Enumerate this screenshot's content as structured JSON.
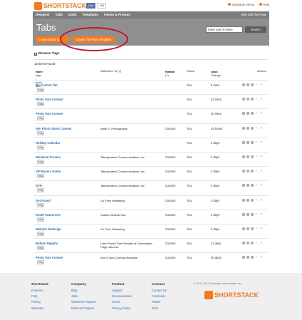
{
  "topbar": {
    "logo_text": "SHORTSTACK",
    "fb_like_label": "Like",
    "fb_like_count": "190",
    "user_name": "Stephanie Sherry",
    "help_label": "Help"
  },
  "nav": {
    "items": [
      "Designer",
      "Tabs",
      "Units",
      "Templates",
      "Forms & Promos"
    ],
    "help_page": "Help with this Page"
  },
  "header": {
    "title": "Tabs",
    "search_placeholder": "Enter part of name",
    "search_button": "Search",
    "create_blank": "Create Blank Tab",
    "create_template": "Create Tab From Template"
  },
  "browse_tags": "Browse Tags",
  "items_found": "13 Items Found",
  "table": {
    "headers": {
      "name": "Name",
      "name_sub": "hide tags | quick add",
      "attribution": "Attribution To (?)",
      "publish": "Publish",
      "publish_sub": "Method (?)",
      "owner": "Owner",
      "shown": "Show",
      "shown_sub": "Last Change",
      "actions": "Actions"
    },
    "rows": [
      {
        "name": "My Contest Tab",
        "tag": "blog",
        "attr": "",
        "pub": "",
        "owner": "You",
        "shown": "5 mins"
      },
      {
        "name": "Photo Vote Contest",
        "tag": "blog",
        "attr": "",
        "pub": "",
        "owner": "You",
        "shown": "22 mins"
      },
      {
        "name": "Photo Vote Contest",
        "tag": "blog",
        "attr": "",
        "pub": "",
        "owner": "You",
        "shown": "30 mins"
      },
      {
        "name": "Win Photo Shoot Contest",
        "tag": "blog",
        "attr": "Mark G. Photography",
        "pub": "Custom",
        "owner": "You",
        "shown": "15 hours"
      },
      {
        "name": "Holiday Calendar",
        "tag": "blog",
        "attr": "",
        "pub": "",
        "owner": "You",
        "shown": "2 days"
      },
      {
        "name": "Weekend Promos",
        "tag": "blog",
        "attr": "Takedynamic Communications, Inc",
        "pub": "Custom",
        "owner": "You",
        "shown": "2 days"
      },
      {
        "name": "VIP Buyers Guide",
        "tag": "blog",
        "attr": "Takedynamic Communications, Inc",
        "pub": "Custom",
        "owner": "You",
        "shown": "3 days"
      },
      {
        "name": "DVR",
        "tag": "blog",
        "attr": "Takedynamic Communications, Inc",
        "pub": "Custom",
        "owner": "You",
        "shown": "3 days"
      },
      {
        "name": "Get Found",
        "tag": "blog",
        "attr": "Go Time Marketing",
        "pub": "Custom",
        "owner": "You",
        "shown": "3 days"
      },
      {
        "name": "SVaW Awareness",
        "tag": "blog",
        "attr": "Solaris Medical Spa",
        "pub": "Custom",
        "owner": "You",
        "shown": "3 days"
      },
      {
        "name": "Website Redesign",
        "tag": "blog",
        "attr": "Go Time Marketing",
        "pub": "Custom",
        "owner": "You",
        "shown": "3 days"
      },
      {
        "name": "Bottom Regatta",
        "tag": "blog",
        "attr": "Lake Powell Time Rentals at Greenwater - Page, Arizona",
        "pub": "Custom",
        "owner": "You",
        "shown": "11 days"
      },
      {
        "name": "Photo Vote Contest",
        "tag": "blog",
        "attr": "Dee's Spot Clothing Boutique",
        "pub": "Custom",
        "owner": "You",
        "shown": "30 days"
      }
    ]
  },
  "footer": {
    "columns": [
      {
        "heading": "Shortstack",
        "links": [
          "Features",
          "FAQ",
          "Pricing",
          "Webinars"
        ]
      },
      {
        "heading": "Company",
        "links": [
          "Blog",
          "Jobs",
          "Weekend Program",
          "Referral Program"
        ]
      },
      {
        "heading": "Product",
        "links": [
          "Support",
          "Documentation",
          "Terms",
          "Privacy Policy"
        ]
      },
      {
        "heading": "Connect",
        "links": [
          "Contact Us",
          "Facebook",
          "Twitter",
          "RSS"
        ]
      }
    ],
    "copyright": "© 2010-2013 Pancake Laboratories, Inc.",
    "logo_text": "SHORTSTACK"
  },
  "colors": {
    "brand_orange": "#f47a20",
    "link_blue": "#2c6fb5",
    "annotation_red": "#c8112c"
  }
}
